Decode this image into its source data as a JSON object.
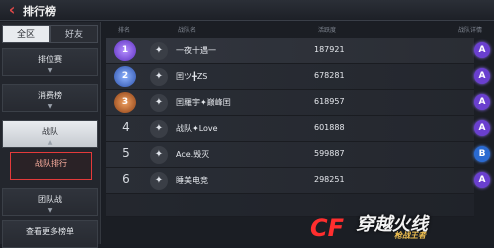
{
  "title": "排行榜",
  "sidebar": {
    "tabs": [
      {
        "label": "全区",
        "active": true
      },
      {
        "label": "好友",
        "active": false
      }
    ],
    "items": [
      {
        "label": "排位赛"
      },
      {
        "label": "消费榜"
      },
      {
        "label": "战队"
      },
      {
        "label": "战队排行"
      },
      {
        "label": "团队战"
      },
      {
        "label": "查看更多榜单"
      }
    ]
  },
  "header": {
    "col_rank": "排名",
    "col_name": "战队名",
    "col_score": "活跃度",
    "col_action": "战队详情"
  },
  "rows": [
    {
      "rank": "1",
      "name": "一夜十遇一",
      "score": "187921"
    },
    {
      "rank": "2",
      "name": "囯ツ╋ZS",
      "score": "678281"
    },
    {
      "rank": "3",
      "name": "囯羅宇✦巅峰囯",
      "score": "618957"
    },
    {
      "rank": "4",
      "name": "战队✦Love",
      "score": "601888"
    },
    {
      "rank": "5",
      "name": "Ace.毁灭",
      "score": "599887"
    },
    {
      "rank": "6",
      "name": "睡美电竞",
      "score": "298251"
    }
  ],
  "logo": {
    "cf": "CF",
    "text": "穿越火线",
    "sub": "枪战王者"
  },
  "colors": {
    "accent": "#e53a3a",
    "purple": "#6a3fcf",
    "blue": "#2a6ad1"
  }
}
